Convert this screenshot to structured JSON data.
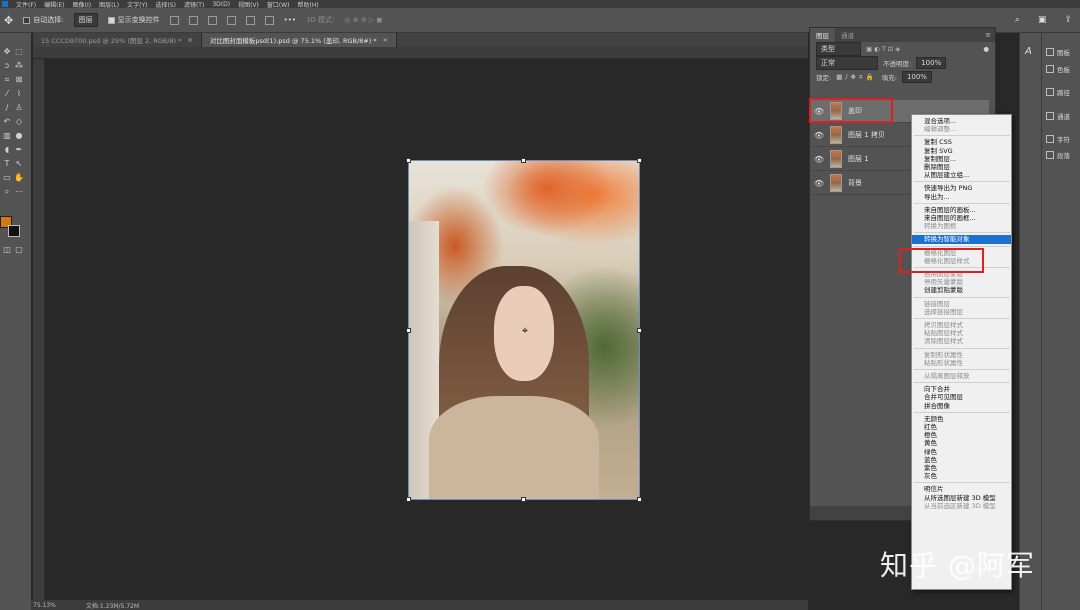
{
  "menubar": {
    "items": [
      "文件(F)",
      "编辑(E)",
      "图像(I)",
      "图层(L)",
      "文字(Y)",
      "选择(S)",
      "滤镜(T)",
      "3D(D)",
      "视图(V)",
      "窗口(W)",
      "帮助(H)"
    ]
  },
  "options_bar": {
    "auto_select_label": "自动选择:",
    "auto_select_target": "图层",
    "show_transform_label": "显示变换控件",
    "mode_3d_label": "3D 模式:",
    "more": "•••"
  },
  "doc_tabs": [
    {
      "label": "15 CCCD9700.psd @ 25% (图层 2, RGB/8) *",
      "active": false
    },
    {
      "label": "对比图封面模板psd(1).psd @ 75.1% (盖印, RGB/8#) *",
      "active": true
    }
  ],
  "status_bar": {
    "zoom": "75.13%",
    "doc_size": "文档:1.23M/5.72M"
  },
  "layers_panel": {
    "tabs": [
      "图层",
      "通道"
    ],
    "filter_kind": "类型",
    "blend_mode": "正常",
    "opacity_label": "不透明度:",
    "opacity_value": "100%",
    "lock_label": "锁定:",
    "fill_label": "填充:",
    "fill_value": "100%",
    "layers": [
      {
        "name": "盖印",
        "selected": true
      },
      {
        "name": "图层 1 拷贝",
        "selected": false
      },
      {
        "name": "图层 1",
        "selected": false
      },
      {
        "name": "背景",
        "selected": false
      }
    ],
    "bottom_icons": [
      "link-icon",
      "fx-icon"
    ]
  },
  "context_menu": {
    "items": [
      {
        "label": "混合选项...",
        "disabled": false
      },
      {
        "label": "编辑调整...",
        "disabled": true
      },
      {
        "sep": true
      },
      {
        "label": "复制 CSS",
        "disabled": false
      },
      {
        "label": "复制 SVG",
        "disabled": false
      },
      {
        "label": "复制图层...",
        "disabled": false
      },
      {
        "label": "删除图层",
        "disabled": false
      },
      {
        "label": "从图层建立组...",
        "disabled": false
      },
      {
        "sep": true
      },
      {
        "label": "快速导出为 PNG",
        "disabled": false
      },
      {
        "label": "导出为...",
        "disabled": false
      },
      {
        "sep": true
      },
      {
        "label": "来自图层的画板...",
        "disabled": false
      },
      {
        "label": "来自图层的画框...",
        "disabled": false
      },
      {
        "label": "转换为图框",
        "disabled": true
      },
      {
        "sep": true
      },
      {
        "label": "转换为智能对象",
        "disabled": false,
        "highlighted": true
      },
      {
        "sep": true
      },
      {
        "label": "栅格化图层",
        "disabled": true
      },
      {
        "label": "栅格化图层样式",
        "disabled": true
      },
      {
        "sep": true
      },
      {
        "label": "启用图层蒙版",
        "disabled": true
      },
      {
        "label": "停用矢量蒙版",
        "disabled": true
      },
      {
        "label": "创建剪贴蒙版",
        "disabled": false
      },
      {
        "sep": true
      },
      {
        "label": "链接图层",
        "disabled": true
      },
      {
        "label": "选择链接图层",
        "disabled": true
      },
      {
        "sep": true
      },
      {
        "label": "拷贝图层样式",
        "disabled": true
      },
      {
        "label": "粘贴图层样式",
        "disabled": true
      },
      {
        "label": "清除图层样式",
        "disabled": true
      },
      {
        "sep": true
      },
      {
        "label": "复制形状属性",
        "disabled": true
      },
      {
        "label": "粘贴形状属性",
        "disabled": true
      },
      {
        "sep": true
      },
      {
        "label": "从隔离图层释放",
        "disabled": true
      },
      {
        "sep": true
      },
      {
        "label": "向下合并",
        "disabled": false
      },
      {
        "label": "合并可见图层",
        "disabled": false
      },
      {
        "label": "拼合图像",
        "disabled": false
      },
      {
        "sep": true
      },
      {
        "label": "无颜色",
        "disabled": false
      },
      {
        "label": "红色",
        "disabled": false
      },
      {
        "label": "橙色",
        "disabled": false
      },
      {
        "label": "黄色",
        "disabled": false
      },
      {
        "label": "绿色",
        "disabled": false
      },
      {
        "label": "蓝色",
        "disabled": false
      },
      {
        "label": "紫色",
        "disabled": false
      },
      {
        "label": "灰色",
        "disabled": false
      },
      {
        "sep": true
      },
      {
        "label": "明信片",
        "disabled": false
      },
      {
        "label": "从所选图层新建 3D 模型",
        "disabled": false
      },
      {
        "label": "从当前选区新建 3D 模型",
        "disabled": true
      }
    ]
  },
  "right_dock": [
    {
      "icon": "adjust-icon",
      "label": "图板"
    },
    {
      "icon": "swatch-icon",
      "label": "色板"
    },
    {
      "icon": "paths-icon",
      "label": "路径"
    },
    {
      "icon": "channels-icon",
      "label": "通道"
    },
    {
      "icon": "char-icon",
      "label": "字符"
    },
    {
      "icon": "para-icon",
      "label": "段落"
    }
  ],
  "watermark": "知乎 @阿军",
  "colors": {
    "highlight": "#1c70d0",
    "annotation_red": "#e02020",
    "foreground_swatch": "#d27a10"
  }
}
